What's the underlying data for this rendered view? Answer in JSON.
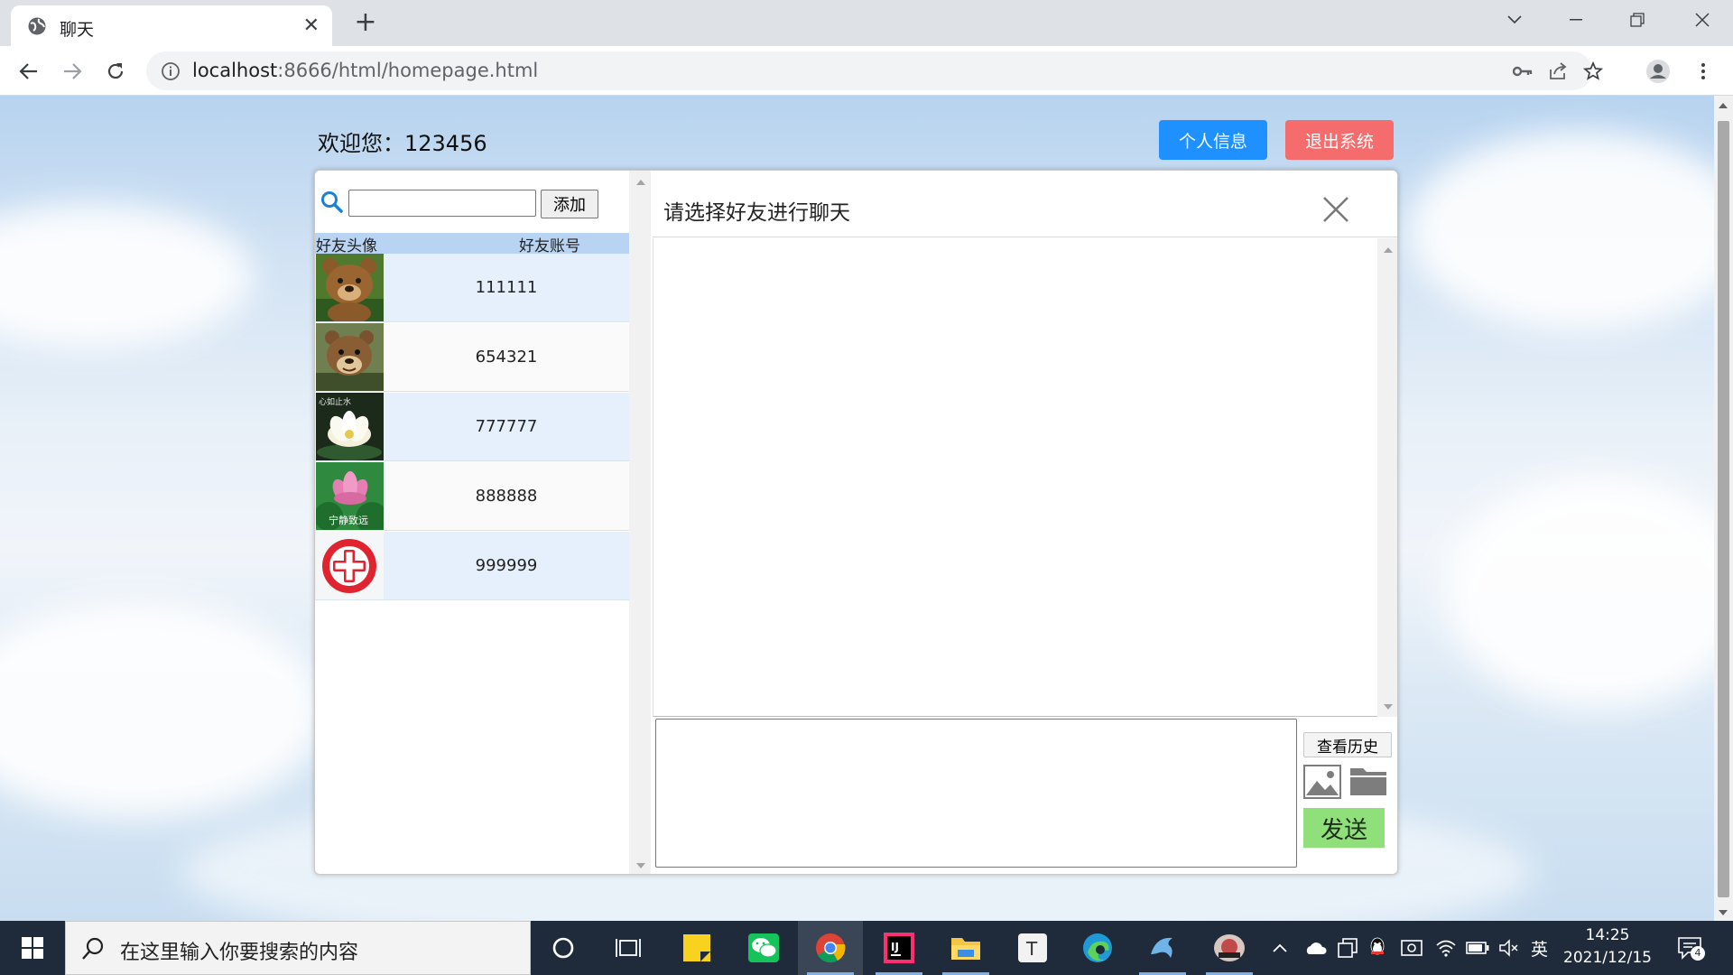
{
  "browser": {
    "tab_title": "聊天",
    "url_host": "localhost",
    "url_path": ":8666/html/homepage.html"
  },
  "page": {
    "welcome": "欢迎您：123456",
    "btn_profile": "个人信息",
    "btn_logout": "退出系统",
    "search_placeholder": "",
    "btn_add": "添加",
    "col_avatar": "好友头像",
    "col_account": "好友账号",
    "friends": [
      {
        "account": "111111",
        "avatar": "bear-brown-icon"
      },
      {
        "account": "654321",
        "avatar": "bear-cartoon-icon"
      },
      {
        "account": "777777",
        "avatar": "lotus-white-icon",
        "avatar_caption": "心如止水"
      },
      {
        "account": "888888",
        "avatar": "lotus-pink-icon",
        "avatar_caption": "宁静致远"
      },
      {
        "account": "999999",
        "avatar": "red-cross-icon"
      }
    ],
    "chat_title": "请选择好友进行聊天",
    "btn_history": "查看历史",
    "btn_send": "发送"
  },
  "taskbar": {
    "search_placeholder": "在这里输入你要搜索的内容",
    "tray_lang": "英",
    "time": "14:25",
    "date": "2021/12/15",
    "notification_count": "4"
  },
  "colors": {
    "profile_button": "#1e90ff",
    "logout_button": "#f56c6c",
    "send_button": "#8fe07a",
    "list_header": "#b9d4f3"
  }
}
